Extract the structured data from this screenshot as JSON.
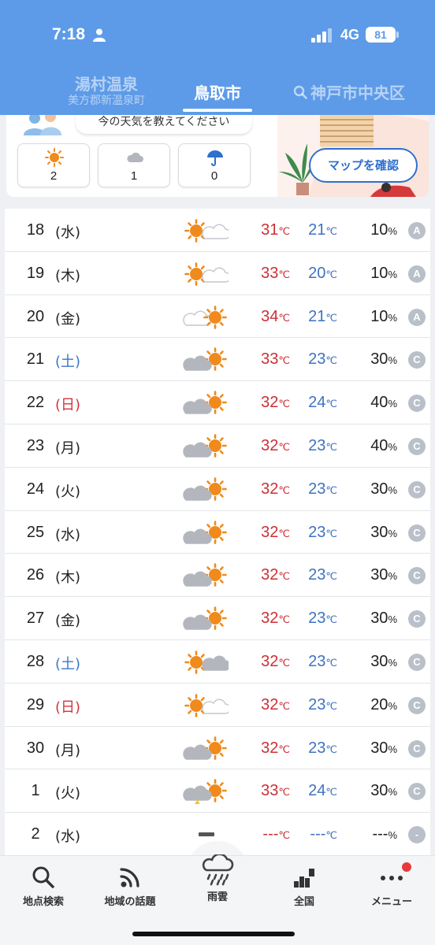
{
  "status": {
    "time": "7:18",
    "network": "4G",
    "battery": "81"
  },
  "tabs": {
    "left": {
      "name": "湯村温泉",
      "sub": "美方郡新温泉町"
    },
    "center": "鳥取市",
    "right": "神戸市中央区"
  },
  "survey": {
    "prompt": "今の天気を教えてください",
    "votes": [
      {
        "icon": "sun-icon",
        "count": "2"
      },
      {
        "icon": "cloud-icon",
        "count": "1"
      },
      {
        "icon": "umbrella-icon",
        "count": "0"
      }
    ],
    "map_button": "マップを確認"
  },
  "forecast": [
    {
      "day": "18",
      "weekday": "(水)",
      "type": "weekday",
      "icon": "sun-cloud",
      "high": "31",
      "low": "21",
      "pop": "10",
      "rel": "A"
    },
    {
      "day": "19",
      "weekday": "(木)",
      "type": "weekday",
      "icon": "sun-cloud",
      "high": "33",
      "low": "20",
      "pop": "10",
      "rel": "A"
    },
    {
      "day": "20",
      "weekday": "(金)",
      "type": "weekday",
      "icon": "cloud-sun-light",
      "high": "34",
      "low": "21",
      "pop": "10",
      "rel": "A"
    },
    {
      "day": "21",
      "weekday": "(土)",
      "type": "sat",
      "icon": "cloud-sun",
      "high": "33",
      "low": "23",
      "pop": "30",
      "rel": "C"
    },
    {
      "day": "22",
      "weekday": "(日)",
      "type": "sun",
      "icon": "cloud-sun",
      "high": "32",
      "low": "24",
      "pop": "40",
      "rel": "C"
    },
    {
      "day": "23",
      "weekday": "(月)",
      "type": "weekday",
      "icon": "cloud-sun",
      "high": "32",
      "low": "23",
      "pop": "40",
      "rel": "C"
    },
    {
      "day": "24",
      "weekday": "(火)",
      "type": "weekday",
      "icon": "cloud-sun",
      "high": "32",
      "low": "23",
      "pop": "30",
      "rel": "C"
    },
    {
      "day": "25",
      "weekday": "(水)",
      "type": "weekday",
      "icon": "cloud-sun",
      "high": "32",
      "low": "23",
      "pop": "30",
      "rel": "C"
    },
    {
      "day": "26",
      "weekday": "(木)",
      "type": "weekday",
      "icon": "cloud-sun",
      "high": "32",
      "low": "23",
      "pop": "30",
      "rel": "C"
    },
    {
      "day": "27",
      "weekday": "(金)",
      "type": "weekday",
      "icon": "cloud-sun",
      "high": "32",
      "low": "23",
      "pop": "30",
      "rel": "C"
    },
    {
      "day": "28",
      "weekday": "(土)",
      "type": "sat",
      "icon": "sun-cloud-dark",
      "high": "32",
      "low": "23",
      "pop": "30",
      "rel": "C"
    },
    {
      "day": "29",
      "weekday": "(日)",
      "type": "sun",
      "icon": "sun-cloud",
      "high": "32",
      "low": "23",
      "pop": "20",
      "rel": "C"
    },
    {
      "day": "30",
      "weekday": "(月)",
      "type": "weekday",
      "icon": "cloud-sun",
      "high": "32",
      "low": "23",
      "pop": "30",
      "rel": "C"
    },
    {
      "day": "1",
      "weekday": "(火)",
      "type": "weekday",
      "icon": "thunder-sun",
      "high": "33",
      "low": "24",
      "pop": "30",
      "rel": "C"
    },
    {
      "day": "2",
      "weekday": "(水)",
      "type": "weekday",
      "icon": "none",
      "high": "---",
      "low": "---",
      "pop": "---",
      "rel": "-"
    }
  ],
  "units": {
    "temp": "℃",
    "pop": "%"
  },
  "nav": [
    {
      "label": "地点検索",
      "icon": "magnifier-icon"
    },
    {
      "label": "地域の話題",
      "icon": "rss-icon"
    },
    {
      "label": "雨雲",
      "icon": "rain-cloud-icon"
    },
    {
      "label": "全国",
      "icon": "map-bars-icon"
    },
    {
      "label": "メニュー",
      "icon": "more-dots-icon"
    }
  ],
  "colors": {
    "header": "#5d9be8",
    "high": "#cc2f35",
    "low": "#3f72c2",
    "sun": "#f08a1c",
    "cloud": "#b3b7bd"
  }
}
